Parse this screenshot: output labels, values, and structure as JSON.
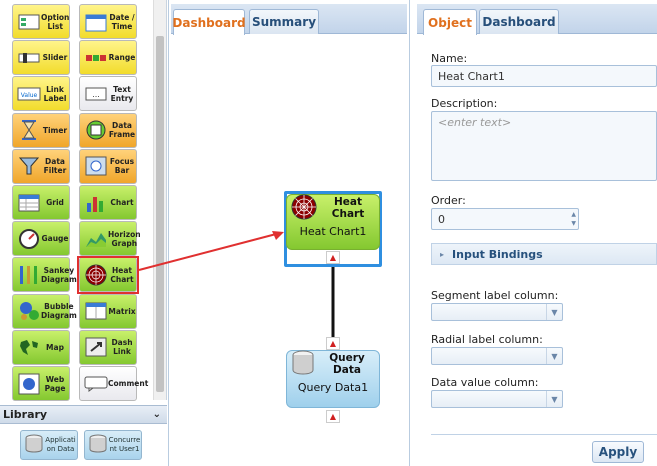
{
  "palette": {
    "items": [
      {
        "label": "Option List",
        "icon": "option-list-icon",
        "color": "yellow"
      },
      {
        "label": "Date / Time",
        "icon": "calendar-icon",
        "color": "yellow"
      },
      {
        "label": "Slider",
        "icon": "slider-icon",
        "color": "yellow"
      },
      {
        "label": "Range",
        "icon": "range-icon",
        "color": "yellow"
      },
      {
        "label": "Link Label",
        "icon": "link-label-icon",
        "color": "yellow",
        "icon_text": "Value"
      },
      {
        "label": "Text Entry",
        "icon": "text-entry-icon",
        "color": "white"
      },
      {
        "label": "Timer",
        "icon": "hourglass-icon",
        "color": "orange"
      },
      {
        "label": "Data Frame",
        "icon": "data-frame-icon",
        "color": "orange"
      },
      {
        "label": "Data Filter",
        "icon": "filter-icon",
        "color": "orange"
      },
      {
        "label": "Focus Bar",
        "icon": "focus-bar-icon",
        "color": "orange"
      },
      {
        "label": "Grid",
        "icon": "grid-icon",
        "color": "green"
      },
      {
        "label": "Chart",
        "icon": "bar-chart-icon",
        "color": "green"
      },
      {
        "label": "Gauge",
        "icon": "gauge-icon",
        "color": "green"
      },
      {
        "label": "Horizon Graph",
        "icon": "horizon-graph-icon",
        "color": "green"
      },
      {
        "label": "Sankey Diagram",
        "icon": "sankey-icon",
        "color": "green"
      },
      {
        "label": "Heat Chart",
        "icon": "heat-chart-icon",
        "color": "green"
      },
      {
        "label": "Bubble Diagram",
        "icon": "bubble-icon",
        "color": "green"
      },
      {
        "label": "Matrix",
        "icon": "matrix-icon",
        "color": "green"
      },
      {
        "label": "Map",
        "icon": "map-icon",
        "color": "green"
      },
      {
        "label": "Dash Link",
        "icon": "dash-link-icon",
        "color": "green"
      },
      {
        "label": "Web Page",
        "icon": "web-page-icon",
        "color": "green"
      },
      {
        "label": "Comment",
        "icon": "comment-icon",
        "color": "white"
      }
    ]
  },
  "library": {
    "title": "Library",
    "toggle": "⌄",
    "items": [
      {
        "label": "Applicati on Data"
      },
      {
        "label": "Concurre nt User1"
      }
    ]
  },
  "canvas": {
    "tabs": [
      {
        "label": "Dashboard"
      },
      {
        "label": "Summary"
      }
    ],
    "active_tab": 0,
    "nodes": {
      "heat": {
        "title": "Heat Chart",
        "name": "Heat Chart1"
      },
      "query": {
        "title": "Query Data",
        "name": "Query Data1"
      }
    },
    "handle_glyph": "▲"
  },
  "properties": {
    "tabs": [
      {
        "label": "Object"
      },
      {
        "label": "Dashboard"
      }
    ],
    "active_tab": 0,
    "name_label": "Name:",
    "name_value": "Heat Chart1",
    "description_label": "Description:",
    "description_placeholder": "<enter text>",
    "order_label": "Order:",
    "order_value": "0",
    "input_bindings_label": "Input Bindings",
    "segment_label": "Segment label column:",
    "radial_label": "Radial label column:",
    "data_value_label": "Data value column:",
    "apply_label": "Apply"
  },
  "colors": {
    "accent_orange": "#e0701e",
    "selection_blue": "#2f8fe0",
    "arrow_red": "#e03030",
    "tab_blue": "#274f7a"
  }
}
